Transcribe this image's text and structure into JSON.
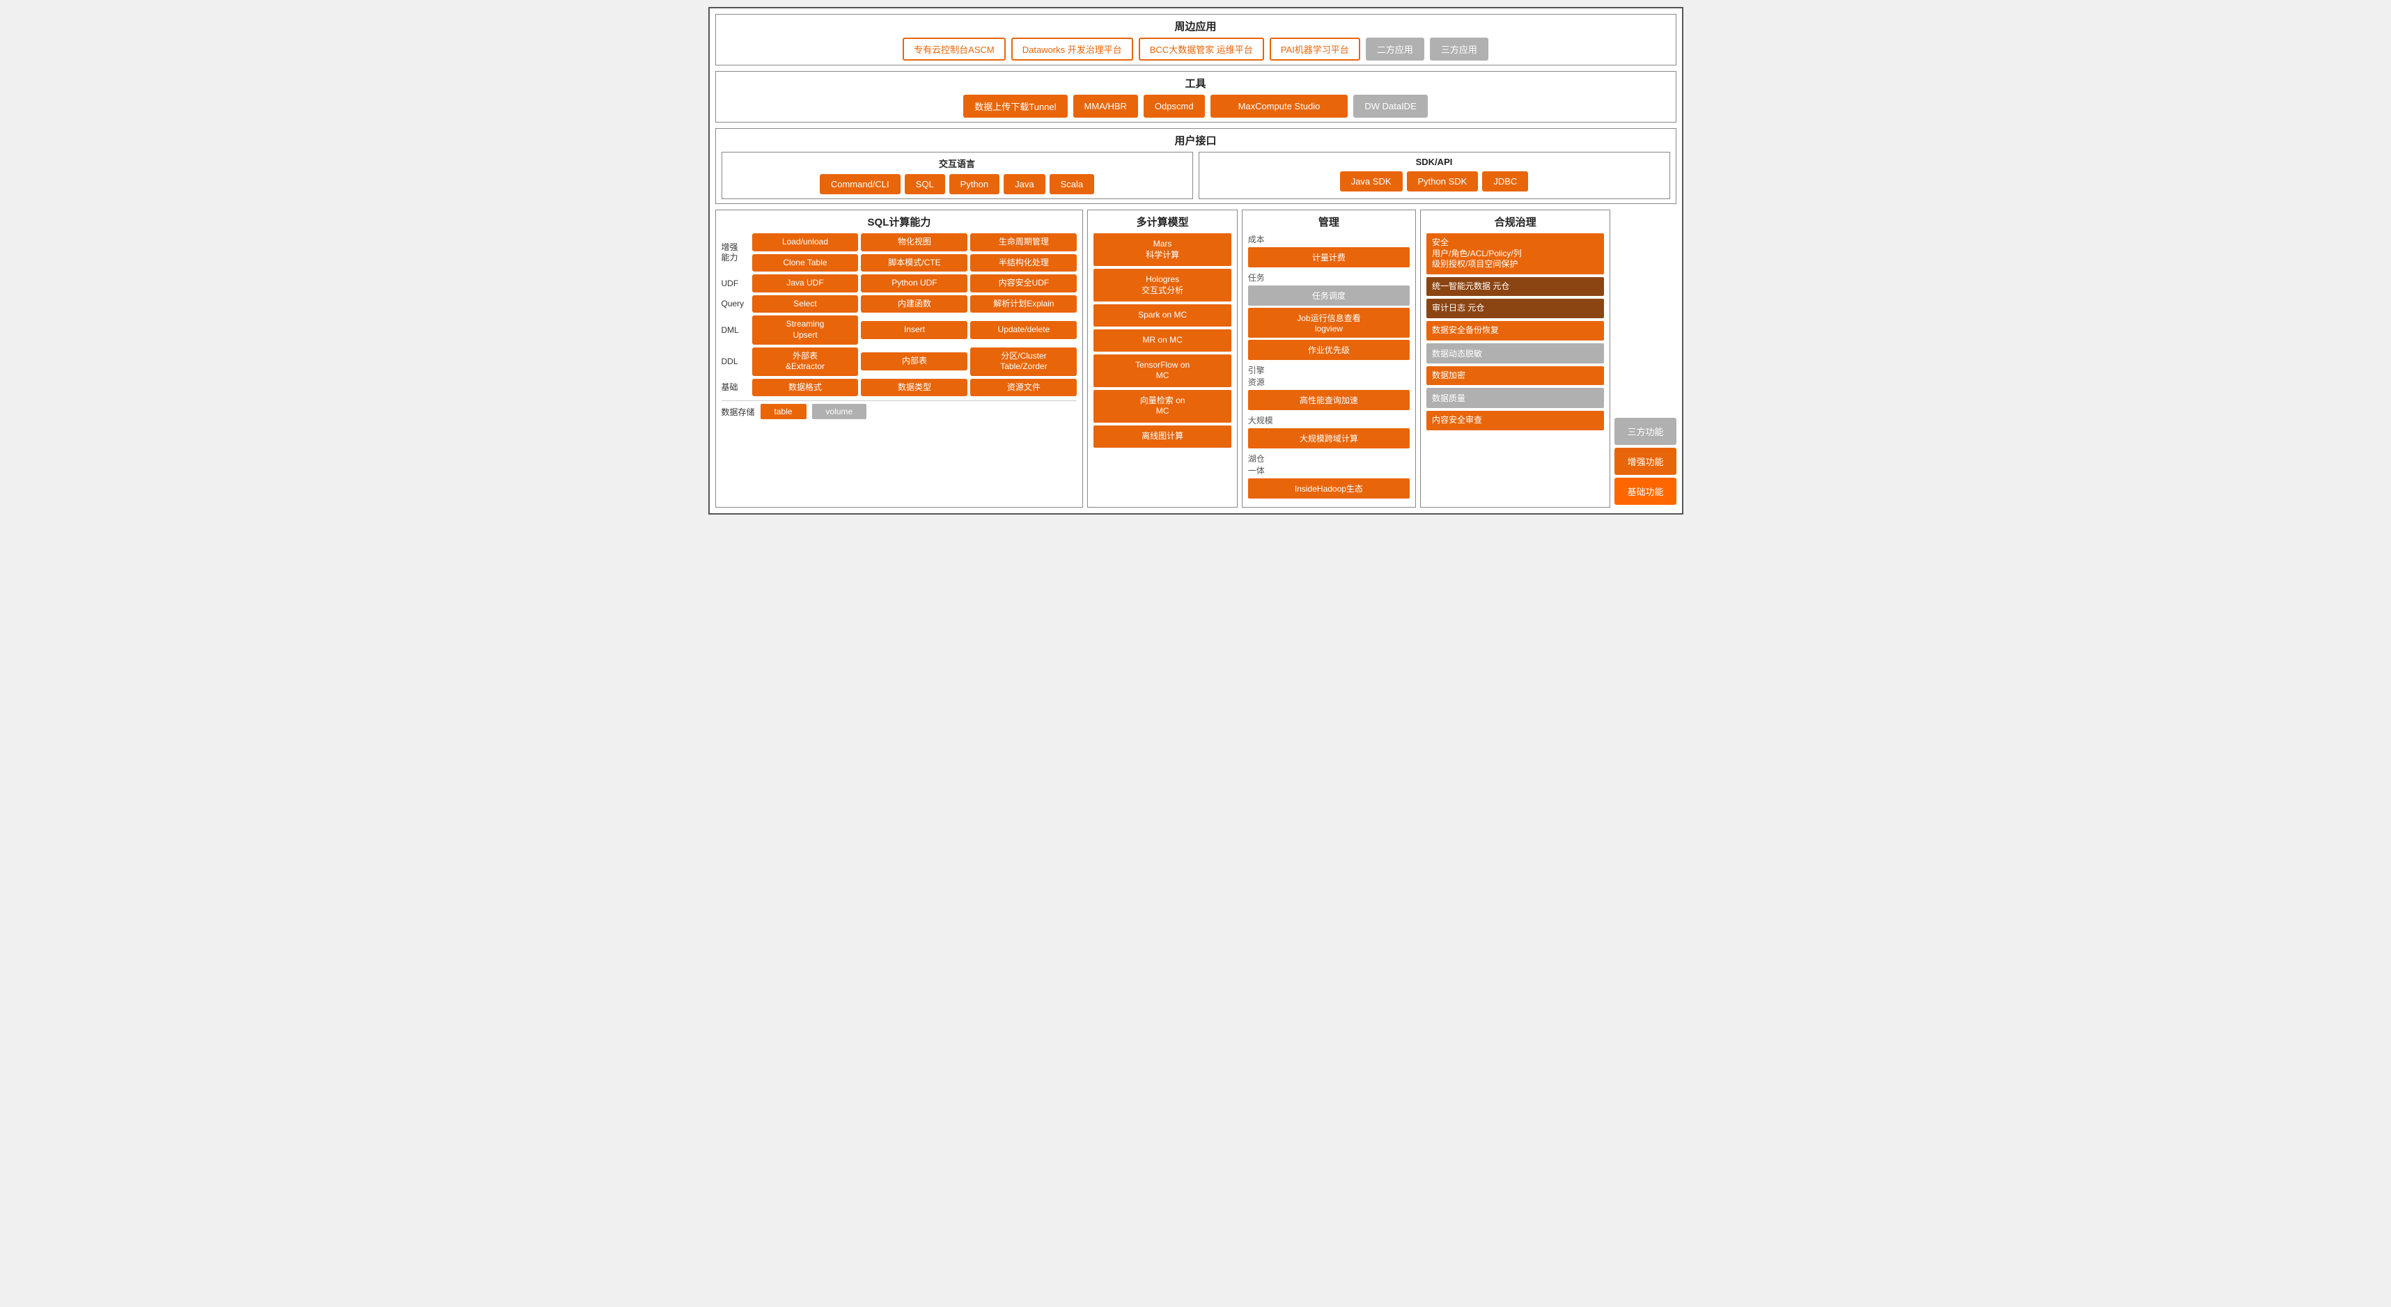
{
  "peripheral": {
    "title": "周边应用",
    "items_outline": [
      "专有云控制台ASCM",
      "Dataworks 开发治理平台",
      "BCC大数据管家 运维平台",
      "PAI机器学习平台"
    ],
    "items_gray": [
      "二方应用",
      "三方应用"
    ]
  },
  "tools": {
    "title": "工具",
    "items_orange": [
      "数据上传下载Tunnel",
      "MMA/HBR",
      "Odpscmd",
      "MaxCompute Studio"
    ],
    "items_gray": [
      "DW DataIDE"
    ]
  },
  "user_interface": {
    "title": "用户接口",
    "interactive_lang": {
      "title": "交互语言",
      "items": [
        "Command/CLI",
        "SQL",
        "Python",
        "Java",
        "Scala"
      ]
    },
    "sdk_api": {
      "title": "SDK/API",
      "items": [
        "Java SDK",
        "Python SDK",
        "JDBC"
      ]
    }
  },
  "sql": {
    "title": "SQL计算能力",
    "rows": [
      {
        "label": "增强\n能力",
        "cells": [
          "Load/unload",
          "物化视图",
          "生命周期管理"
        ]
      },
      {
        "label": "",
        "cells": [
          "Clone Table",
          "脚本模式/CTE",
          "半结构化处理"
        ]
      },
      {
        "label": "UDF",
        "cells": [
          "Java UDF",
          "Python UDF",
          "内容安全UDF"
        ]
      },
      {
        "label": "Query",
        "cells": [
          "Select",
          "内建函数",
          "解析计划Explain"
        ]
      },
      {
        "label": "DML",
        "cells": [
          "Streaming\nUpsert",
          "Insert",
          "Update/delete"
        ]
      },
      {
        "label": "DDL",
        "cells": [
          "外部表\n&Extractor",
          "内部表",
          "分区/Cluster\nTable/Zorder"
        ]
      },
      {
        "label": "基础",
        "cells": [
          "数据格式",
          "数据类型",
          "资源文件"
        ]
      }
    ],
    "storage": {
      "label": "数据存储",
      "btn1": "table",
      "btn2": "volume"
    }
  },
  "multi_compute": {
    "title": "多计算模型",
    "items": [
      "Mars\n科学计算",
      "Hologres\n交互式分析",
      "Spark on MC",
      "MR on MC",
      "TensorFlow on\nMC",
      "向量检索 on\nMC",
      "离线图计算"
    ]
  },
  "management": {
    "title": "管理",
    "sections": [
      {
        "label": "成本",
        "items_orange": [
          "计量计费"
        ],
        "items_gray": []
      },
      {
        "label": "任务",
        "items_orange": [
          "Job运行信息查看\nlogview",
          "作业优先级"
        ],
        "items_gray": [
          "任务调度"
        ]
      },
      {
        "label": "引擎\n资源",
        "items_orange": [
          "高性能查询加速"
        ],
        "items_gray": []
      },
      {
        "label": "大规模",
        "items_orange": [
          "大规模跨域计算"
        ],
        "items_gray": []
      },
      {
        "label": "湖仓\n一体",
        "items_orange": [
          "InsideHadoop生态"
        ],
        "items_gray": []
      }
    ]
  },
  "compliance": {
    "title": "合规治理",
    "items": [
      {
        "text": "安全\n用户/角色/ACL/Policy/列\n级别授权/项目空间保护",
        "type": "orange"
      },
      {
        "text": "统一智能元数据 元仓",
        "type": "dark"
      },
      {
        "text": "审计日志 元仓",
        "type": "dark"
      },
      {
        "text": "数据安全备份恢复",
        "type": "orange"
      },
      {
        "text": "数据动态脱敏",
        "type": "gray"
      },
      {
        "text": "数据加密",
        "type": "orange"
      },
      {
        "text": "数据质量",
        "type": "gray"
      },
      {
        "text": "内容安全审查",
        "type": "orange"
      }
    ]
  },
  "legend": {
    "items": [
      {
        "text": "三方功能",
        "type": "gray"
      },
      {
        "text": "增强功能",
        "type": "orange"
      },
      {
        "text": "基础功能",
        "type": "bright-orange"
      }
    ]
  }
}
